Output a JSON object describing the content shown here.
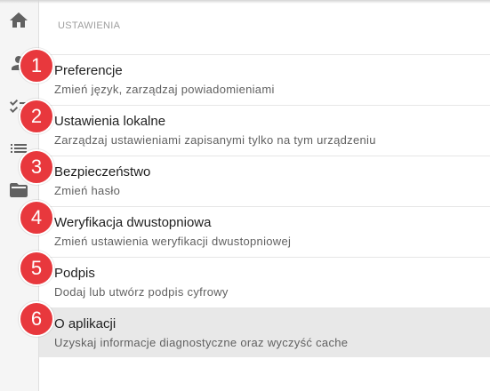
{
  "sidebar": {
    "icons": [
      "home-icon",
      "person-icon",
      "checklist-icon",
      "list-icon",
      "folder-icon"
    ]
  },
  "settings": {
    "section_title": "USTAWIENIA",
    "items": [
      {
        "badge": "1",
        "title": "Preferencje",
        "subtitle": "Zmień język, zarządzaj powiadomieniami"
      },
      {
        "badge": "2",
        "title": "Ustawienia lokalne",
        "subtitle": "Zarządzaj ustawieniami zapisanymi tylko na tym urządzeniu"
      },
      {
        "badge": "3",
        "title": "Bezpieczeństwo",
        "subtitle": "Zmień hasło"
      },
      {
        "badge": "4",
        "title": "Weryfikacja dwustopniowa",
        "subtitle": "Zmień ustawienia weryfikacji dwustopniowej"
      },
      {
        "badge": "5",
        "title": "Podpis",
        "subtitle": "Dodaj lub utwórz podpis cyfrowy"
      },
      {
        "badge": "6",
        "title": "O aplikacji",
        "subtitle": "Uzyskaj informacje diagnostyczne oraz wyczyść cache"
      }
    ],
    "active_index": 5
  },
  "colors": {
    "badge": "#e8383d",
    "active_row": "#e8e8e8",
    "rail": "#f5f5f5"
  }
}
